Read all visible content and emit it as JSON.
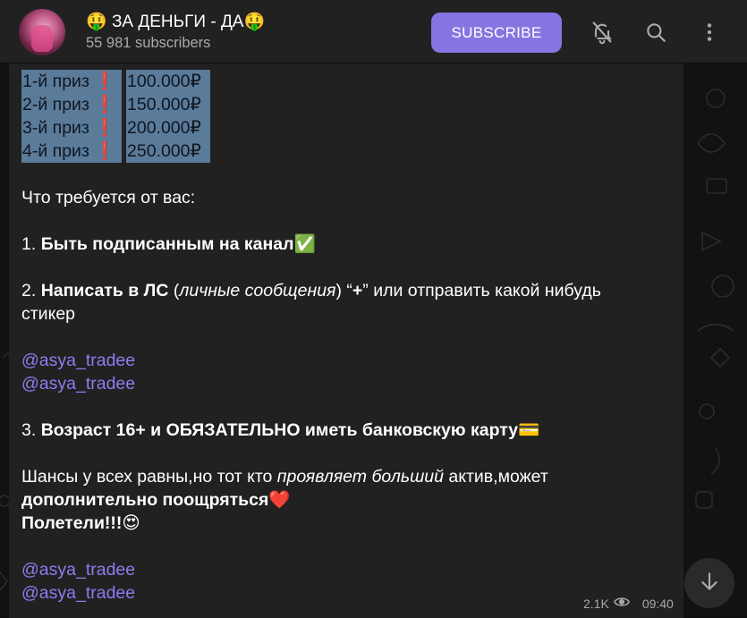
{
  "channel": {
    "emoji_left": "🤑",
    "name": "ЗА ДЕНЬГИ - ДА",
    "emoji_right": "🤑",
    "subscribers": "55 981 subscribers",
    "subscribe_label": "SUBSCRIBE"
  },
  "message": {
    "prizes": [
      {
        "label": "1-й приз",
        "amount": "100.000₽"
      },
      {
        "label": "2-й приз",
        "amount": "150.000₽"
      },
      {
        "label": "3-й приз",
        "amount": "200.000₽"
      },
      {
        "label": "4-й приз",
        "amount": "250.000₽"
      }
    ],
    "requirements_intro": "Что требуется от вас:",
    "req1_num": "1. ",
    "req1_text": "Быть подписанным на канал",
    "req1_emoji": "✅",
    "req2_num": "2. ",
    "req2_bold": "Написать в ЛС",
    "req2_paren_open": " (",
    "req2_italic": "личные сообщения",
    "req2_paren_close": ") “",
    "req2_plus": "+",
    "req2_rest": "” или отправить какой нибудь",
    "req2_line2": "стикер",
    "link1": "@asya_tradee",
    "link2": "@asya_tradee",
    "req3_num": "3. ",
    "req3_text": "Возраст 16+ и ОБЯЗАТЕЛЬНО иметь банковскую карту",
    "req3_emoji": "💳",
    "chances_start": "Шансы у всех равны,но тот кто ",
    "chances_italic": "проявляет больший",
    "chances_end": " актив,может",
    "chances_bold": "дополнительно поощряться",
    "chances_emoji": "❤️",
    "go_text": "Полетели!!!",
    "go_emoji": "😍",
    "link3": "@asya_tradee",
    "link4": "@asya_tradee",
    "views": "2.1K",
    "time": "09:40"
  }
}
